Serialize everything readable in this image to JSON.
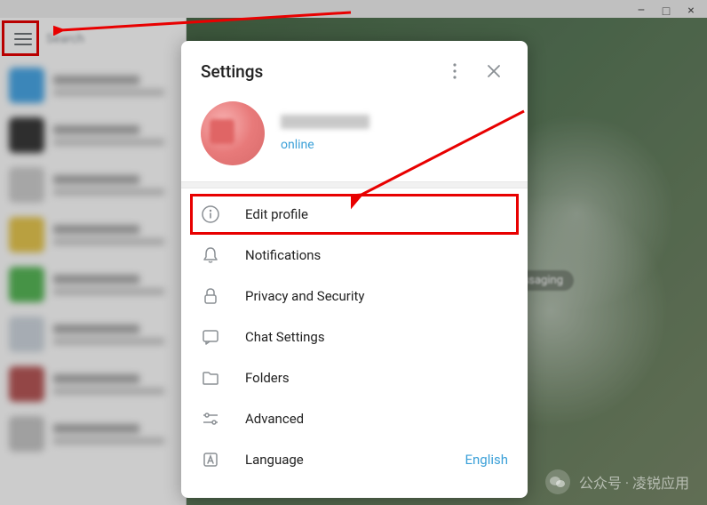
{
  "window": {
    "title_controls": [
      "–",
      "□",
      "×"
    ]
  },
  "sidebar": {
    "search_placeholder": "Search",
    "chats": [
      {
        "color": "#4aa8e8"
      },
      {
        "color": "#3a3a3a"
      },
      {
        "color": "#d0d0d0"
      },
      {
        "color": "#e8c850"
      },
      {
        "color": "#58b858"
      },
      {
        "color": "#d0d8e0"
      },
      {
        "color": "#b85858"
      },
      {
        "color": "#c8c8c8"
      }
    ]
  },
  "main": {
    "bubble_text": "ssaging"
  },
  "settings": {
    "title": "Settings",
    "profile": {
      "status": "online"
    },
    "items": [
      {
        "icon": "info-icon",
        "label": "Edit profile",
        "highlight": true
      },
      {
        "icon": "bell-icon",
        "label": "Notifications"
      },
      {
        "icon": "lock-icon",
        "label": "Privacy and Security"
      },
      {
        "icon": "chat-icon",
        "label": "Chat Settings"
      },
      {
        "icon": "folder-icon",
        "label": "Folders"
      },
      {
        "icon": "advanced-icon",
        "label": "Advanced"
      },
      {
        "icon": "language-icon",
        "label": "Language",
        "value": "English"
      }
    ]
  },
  "watermark": {
    "text": "公众号 · 凌锐应用"
  }
}
